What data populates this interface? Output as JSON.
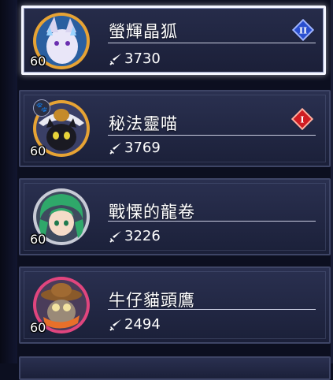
{
  "roster": {
    "items": [
      {
        "name": "螢輝晶狐",
        "level": "60",
        "power": "3730",
        "selected": true,
        "rank_badge": "II",
        "rank_color": "#2a4fcf",
        "ring_color": "#e7a334",
        "has_paw": false,
        "avatar": "crystal-fox"
      },
      {
        "name": "秘法靈喵",
        "level": "60",
        "power": "3769",
        "selected": false,
        "rank_badge": "I",
        "rank_color": "#d01d22",
        "ring_color": "#e7a334",
        "has_paw": true,
        "paw_icon": "🐾",
        "avatar": "arcane-cat"
      },
      {
        "name": "戰慄的龍卷",
        "level": "60",
        "power": "3226",
        "selected": false,
        "rank_badge": "",
        "rank_color": "",
        "ring_color": "#c8cbd6",
        "has_paw": false,
        "avatar": "tatsumaki"
      },
      {
        "name": "牛仔貓頭鷹",
        "level": "60",
        "power": "2494",
        "selected": false,
        "rank_badge": "",
        "rank_color": "",
        "ring_color": "#e0457e",
        "has_paw": false,
        "avatar": "cowboy-owl"
      }
    ]
  },
  "icons": {
    "power": "sword-icon",
    "paw": "paw-icon"
  }
}
